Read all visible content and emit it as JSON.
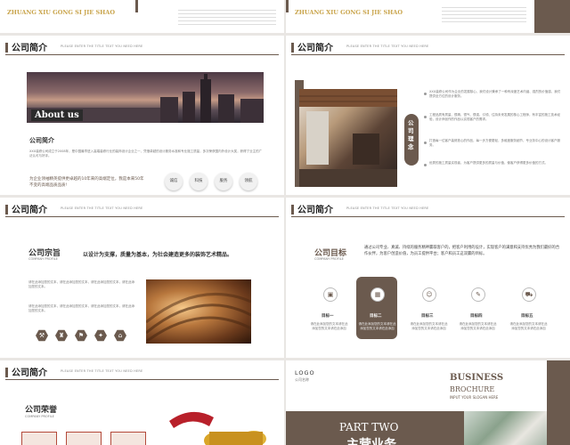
{
  "slides": {
    "s1": {
      "brand": "ZHUANG XIU GONG SI JIE SHAO"
    },
    "s2": {
      "brand": "ZHUANG XIU GONG SI JIE SHAO"
    },
    "s3": {
      "title": "公司简介",
      "subtitle": "PLEASE ENTER THE TITLE TEXT YOU NEED HERE",
      "banner_label": "About us",
      "section_title": "公司简介",
      "body": "XXX装修公司成立于2008年，是中国最早进入高端装修行业的装饰设计企业之一，凭借卓越的设计服务水准和专业施工质量，多次荣获国内外设计大奖，获得了业主的广泛认可与好评。",
      "highlight": "为企业领袖精英提供更卓越的10年来的高端定位，我是本来50年不变的高端品质品质!",
      "pills": [
        "诚信",
        "科技",
        "服务",
        "领航"
      ]
    },
    "s4": {
      "title": "公司简介",
      "subtitle": "PLEASE ENTER THE TITLE TEXT YOU NEED HERE",
      "vertical_label": "公司理念",
      "bullets": [
        "XXX装修公司作为企业的发展核心，我们设计秉承了一种有深度艺术内涵、强烈的价值感，我们提供全方位的设计服务。",
        "工程品质有质量、很精、很气、很强、引领、住持未来发展的核心工程师，有丰富的施工技术经验，设计师创作的作品以实现客户的需求。",
        "打造每一位客户装修放心的作品，每一步方便更轻，多维度服务细节，专业务中心的设计客户服务。",
        "优秀的施工质量实现者，为客户提供更多的质量与价值，使客户获得更多价值的方式。"
      ]
    },
    "s5": {
      "title": "公司简介",
      "subtitle": "PLEASE ENTER THE TITLE TEXT YOU NEED HERE",
      "heading": "公司宗旨",
      "heading_en": "COMPANY PROFILE",
      "slogan": "以设计为支撑，质量为基本，为社会建造更多的装饰艺术精品。",
      "para1": "请在此添加您的文本，请在此添加您的文本，请在此添加您的文本，请在此添加您的文本。",
      "para2": "请在此添加您的文本，请在此添加您的文本，请在此添加您的文本，请在此添加您的文本。"
    },
    "s6": {
      "title": "公司简介",
      "subtitle": "PLEASE ENTER THE TITLE TEXT YOU NEED HERE",
      "heading": "公司目标",
      "heading_en": "COMPANY PROFILE",
      "intro": "通过公司专业、真诚、持续的服务精神赢取客户的，把客户利用的设计，实现客户的满意和支持优秀为我们最好的合作伙伴，为客户创造价值，为员工提供平台；客户和员工这双赢的目标。",
      "targets": [
        {
          "label": "目标一",
          "desc": "请在此添加您的文本请在此添加您的文本请在此添加"
        },
        {
          "label": "目标二",
          "desc": "请在此添加您的文本请在此添加您的文本请在此添加"
        },
        {
          "label": "目标三",
          "desc": "请在此添加您的文本请在此添加您的文本请在此添加"
        },
        {
          "label": "目标四",
          "desc": "请在此添加您的文本请在此添加您的文本请在此添加"
        },
        {
          "label": "目标五",
          "desc": "请在此添加您的文本请在此添加您的文本请在此添加"
        }
      ]
    },
    "s7": {
      "title": "公司简介",
      "subtitle": "PLEASE ENTER THE TITLE TEXT YOU NEED HERE",
      "heading": "公司荣誉",
      "heading_en": "COMPANY PROFILE"
    },
    "s8": {
      "logo": "LOGO",
      "company": "公司名称",
      "business": "BUSINESS",
      "brochure": "BROCHURE",
      "slogan": "INPUT YOUR SLOGAN HERE",
      "part": "PART TWO",
      "part_cn": "主营业务"
    }
  }
}
